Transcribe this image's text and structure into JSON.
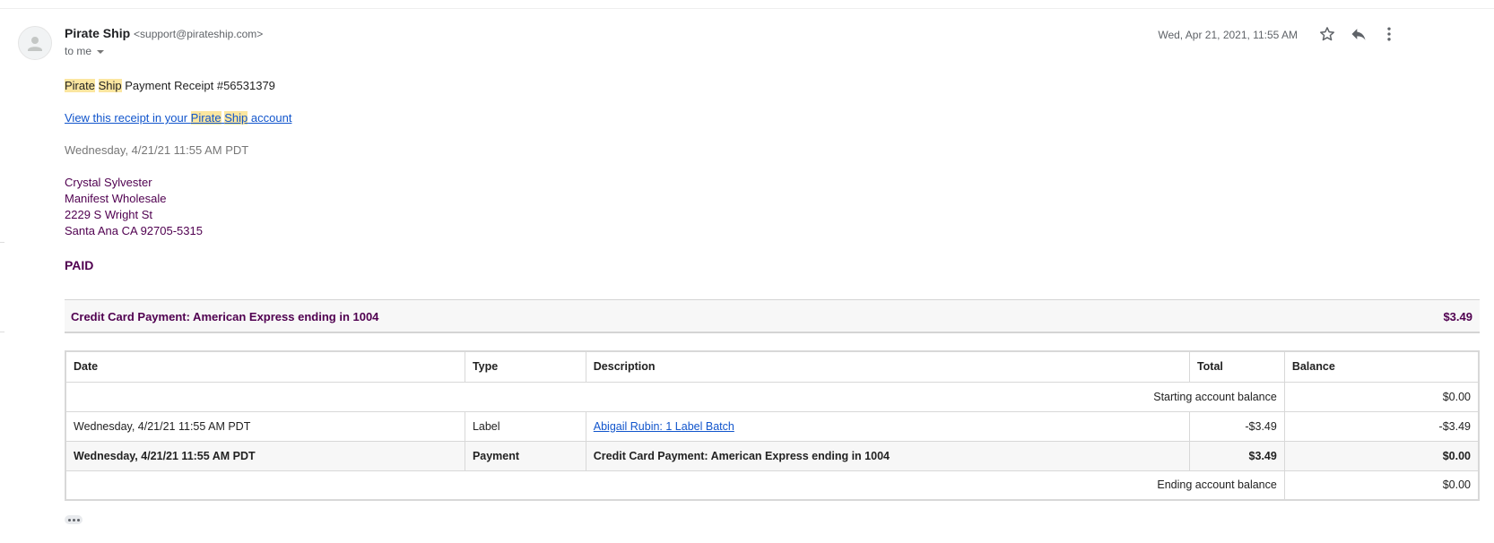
{
  "email": {
    "sender_name": "Pirate Ship",
    "sender_email": "<support@pirateship.com>",
    "to_label": "to me",
    "date": "Wed, Apr 21, 2021, 11:55 AM",
    "icons": [
      "star-icon",
      "reply-icon",
      "more-vert-icon"
    ]
  },
  "receipt": {
    "title_part1": "Pirate",
    "title_part2": "Ship",
    "title_rest": " Payment Receipt #56531379",
    "link_prefix": "View this receipt in your ",
    "link_hl1": "Pirate",
    "link_hl2": "Ship",
    "link_suffix": " account",
    "date": "Wednesday, 4/21/21 11:55 AM PDT",
    "address": [
      "Crystal Sylvester",
      "Manifest Wholesale",
      "2229 S Wright St",
      "Santa Ana CA 92705-5315"
    ],
    "status": "PAID",
    "payment_label": "Credit Card Payment: American Express ending in 1004",
    "payment_amount": "$3.49"
  },
  "table": {
    "headers": [
      "Date",
      "Type",
      "Description",
      "Total",
      "Balance"
    ],
    "starting_label": "Starting account balance",
    "starting_balance": "$0.00",
    "rows": [
      {
        "date": "Wednesday, 4/21/21 11:55 AM PDT",
        "type": "Label",
        "description": "Abigail Rubin: 1 Label Batch",
        "total": "-$3.49",
        "balance": "-$3.49"
      },
      {
        "date": "Wednesday, 4/21/21 11:55 AM PDT",
        "type": "Payment",
        "description": "Credit Card Payment: American Express ending in 1004",
        "total": "$3.49",
        "balance": "$0.00"
      }
    ],
    "ending_label": "Ending account balance",
    "ending_balance": "$0.00"
  },
  "colors": {
    "link": "#1155cc",
    "highlight": "#fbe6a0",
    "visited_purple": "#500050"
  }
}
